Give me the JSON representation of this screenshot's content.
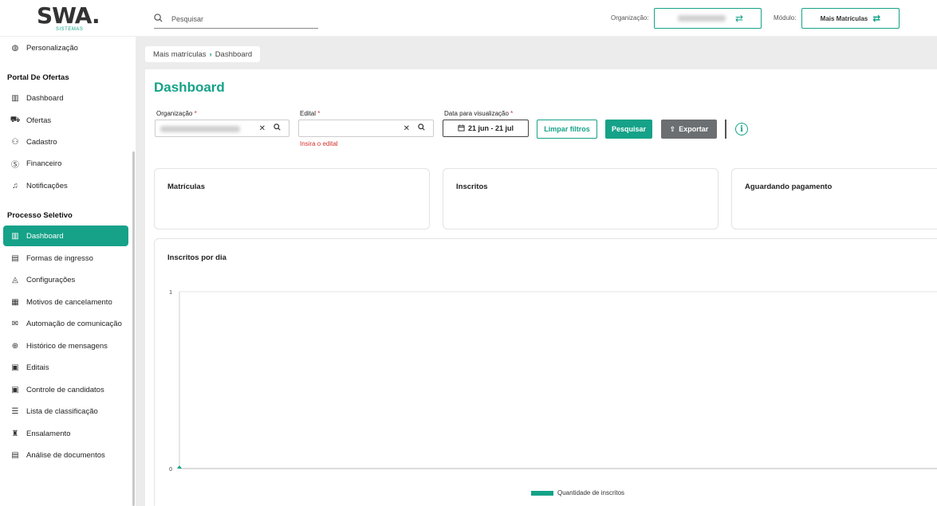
{
  "header": {
    "logo_text": "SWA.",
    "logo_subtitle": "SISTEMAS",
    "search_placeholder": "Pesquisar",
    "organization_label": "Organização:",
    "module_label": "Módulo:",
    "module_value": "Mais Matrículas"
  },
  "sidebar": {
    "top_item": {
      "label": "Personalização",
      "icon": "palette-icon"
    },
    "sections": [
      {
        "title": "Portal De Ofertas",
        "items": [
          {
            "label": "Dashboard",
            "icon": "dashboard-icon"
          },
          {
            "label": "Ofertas",
            "icon": "cart-icon"
          },
          {
            "label": "Cadastro",
            "icon": "user-edit-icon"
          },
          {
            "label": "Financeiro",
            "icon": "dollar-circle-icon"
          },
          {
            "label": "Notificações",
            "icon": "bell-icon"
          }
        ]
      },
      {
        "title": "Processo Seletivo",
        "items": [
          {
            "label": "Dashboard",
            "icon": "dashboard-icon",
            "active": true
          },
          {
            "label": "Formas de ingresso",
            "icon": "form-icon"
          },
          {
            "label": "Configurações",
            "icon": "graduation-cap-icon"
          },
          {
            "label": "Motivos de cancelamento",
            "icon": "document-icon"
          },
          {
            "label": "Automação de comunicação",
            "icon": "mail-icon"
          },
          {
            "label": "Histórico de mensagens",
            "icon": "message-history-icon"
          },
          {
            "label": "Editais",
            "icon": "calendar-edit-icon"
          },
          {
            "label": "Controle de candidatos",
            "icon": "id-card-icon"
          },
          {
            "label": "Lista de classificação",
            "icon": "list-icon"
          },
          {
            "label": "Ensalamento",
            "icon": "classroom-icon"
          },
          {
            "label": "Análise de documentos",
            "icon": "document-check-icon"
          }
        ]
      }
    ]
  },
  "breadcrumb": {
    "parent": "Mais matrículas",
    "current": "Dashboard"
  },
  "page": {
    "title": "Dashboard"
  },
  "filters": {
    "organizacao_label": "Organização",
    "edital_label": "Edital",
    "edital_error": "Insira o edital",
    "date_label": "Data para visualização",
    "date_value": "21 jun - 21 jul",
    "required_mark": "*",
    "clear_label": "Limpar filtros",
    "search_label": "Pesquisar",
    "export_label": "Exportar"
  },
  "cards": [
    {
      "title": "Matrículas"
    },
    {
      "title": "Inscritos"
    },
    {
      "title": "Aguardando pagamento"
    }
  ],
  "colors": {
    "accent": "#15a288",
    "error": "#d32f2f"
  },
  "chart_data": {
    "type": "line",
    "title": "Inscritos por dia",
    "series": [
      {
        "name": "Quantidade de inscritos",
        "values": [
          0
        ]
      }
    ],
    "ylim": [
      0,
      1
    ],
    "yticks": [
      "1",
      "0"
    ],
    "grid": true,
    "legend": "bottom"
  }
}
